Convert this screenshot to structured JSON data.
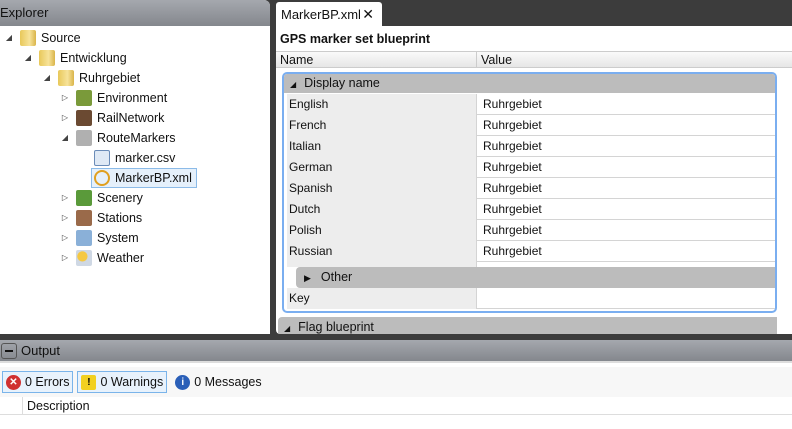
{
  "explorer": {
    "title": "Explorer",
    "items": [
      {
        "label": "Source",
        "icon": "folder-icon"
      },
      {
        "label": "Entwicklung",
        "icon": "folder-icon"
      },
      {
        "label": "Ruhrgebiet",
        "icon": "folder-icon"
      },
      {
        "label": "Environment",
        "icon": "environment-icon"
      },
      {
        "label": "RailNetwork",
        "icon": "railnetwork-icon"
      },
      {
        "label": "RouteMarkers",
        "icon": "routemarkers-icon"
      },
      {
        "label": "marker.csv",
        "icon": "csv-file-icon"
      },
      {
        "label": "MarkerBP.xml",
        "icon": "blueprint-file-icon"
      },
      {
        "label": "Scenery",
        "icon": "scenery-icon"
      },
      {
        "label": "Stations",
        "icon": "stations-icon"
      },
      {
        "label": "System",
        "icon": "system-icon"
      },
      {
        "label": "Weather",
        "icon": "weather-icon"
      }
    ]
  },
  "tab": {
    "label": "MarkerBP.xml",
    "close": "✕"
  },
  "doc": {
    "title": "GPS marker set blueprint",
    "col_name": "Name",
    "col_value": "Value",
    "group": "Display name",
    "rows": [
      {
        "name": "English",
        "value": "Ruhrgebiet"
      },
      {
        "name": "French",
        "value": "Ruhrgebiet"
      },
      {
        "name": "Italian",
        "value": "Ruhrgebiet"
      },
      {
        "name": "German",
        "value": "Ruhrgebiet"
      },
      {
        "name": "Spanish",
        "value": "Ruhrgebiet"
      },
      {
        "name": "Dutch",
        "value": "Ruhrgebiet"
      },
      {
        "name": "Polish",
        "value": "Ruhrgebiet"
      },
      {
        "name": "Russian",
        "value": "Ruhrgebiet"
      }
    ],
    "other": "Other",
    "key": "Key",
    "key_value": "",
    "next_group": "Flag blueprint"
  },
  "output": {
    "title": "Output",
    "errors": "0 Errors",
    "warnings": "0 Warnings",
    "messages": "0 Messages",
    "col_description": "Description"
  }
}
